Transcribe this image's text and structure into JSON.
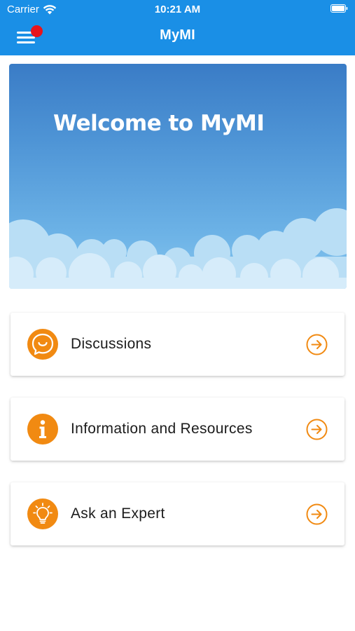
{
  "status": {
    "carrier": "Carrier",
    "time": "10:21 AM"
  },
  "nav": {
    "title": "MyMI"
  },
  "hero": {
    "title": "Welcome to MyMI"
  },
  "menu": {
    "items": [
      {
        "label": "Discussions",
        "icon": "chat-bubble-icon"
      },
      {
        "label": "Information and Resources",
        "icon": "info-icon"
      },
      {
        "label": "Ask an Expert",
        "icon": "lightbulb-icon"
      }
    ]
  },
  "colors": {
    "topbar": "#1a8fe6",
    "accent_orange": "#f18a12",
    "notification_red": "#e8141c"
  }
}
